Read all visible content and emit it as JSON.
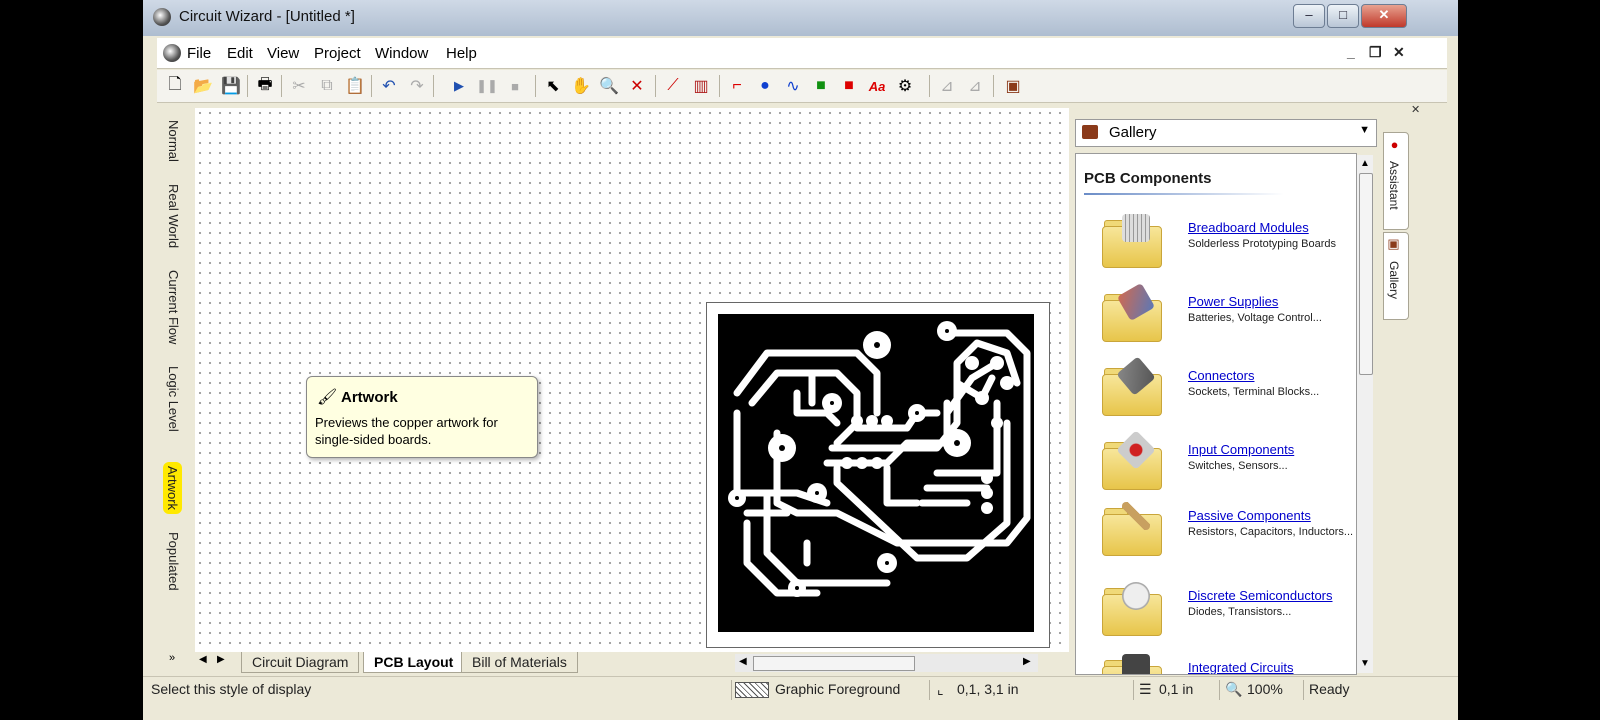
{
  "window": {
    "title": "Circuit Wizard - [Untitled *]"
  },
  "menu": {
    "items": [
      "File",
      "Edit",
      "View",
      "Project",
      "Window",
      "Help"
    ]
  },
  "display_modes": [
    "Normal",
    "Real World",
    "Current Flow",
    "Logic Level",
    "Artwork",
    "Populated"
  ],
  "tooltip": {
    "title": "Artwork",
    "body": "Previews the copper artwork for single-sided boards."
  },
  "doc_tabs": [
    "Circuit Diagram",
    "PCB Layout",
    "Bill of Materials"
  ],
  "status": {
    "message": "Select this style of display",
    "layer": "Graphic Foreground",
    "coords": "0,1, 3,1 in",
    "grid": "0,1 in",
    "zoom": "100%",
    "state": "Ready"
  },
  "gallery": {
    "dropdown_label": "Gallery",
    "heading": "PCB Components",
    "items": [
      {
        "name": "Breadboard Modules",
        "desc": "Solderless Prototyping Boards"
      },
      {
        "name": "Power Supplies",
        "desc": "Batteries, Voltage Control..."
      },
      {
        "name": "Connectors",
        "desc": "Sockets, Terminal Blocks..."
      },
      {
        "name": "Input Components",
        "desc": "Switches, Sensors..."
      },
      {
        "name": "Passive Components",
        "desc": "Resistors, Capacitors, Inductors..."
      },
      {
        "name": "Discrete Semiconductors",
        "desc": "Diodes, Transistors..."
      },
      {
        "name": "Integrated Circuits",
        "desc": ""
      }
    ]
  },
  "side_tabs": [
    "Assistant",
    "Gallery"
  ],
  "icons": [
    "new-icon",
    "open-icon",
    "save-icon",
    "print-icon",
    "cut-icon",
    "copy-icon",
    "paste-icon",
    "undo-icon",
    "redo-icon",
    "play-icon",
    "pause-icon",
    "stop-icon",
    "select-icon",
    "pan-icon",
    "zoom-icon",
    "delete-icon",
    "probe-icon",
    "graph-icon",
    "track-icon",
    "pad-icon",
    "curve-icon",
    "rect-icon",
    "fill-icon",
    "text-icon",
    "chip-icon",
    "flip-icon",
    "mirror-icon",
    "gallery-icon"
  ],
  "colors": {
    "accent": "#0000cc",
    "highlight": "#ffe900",
    "copper_board": "#000000"
  }
}
